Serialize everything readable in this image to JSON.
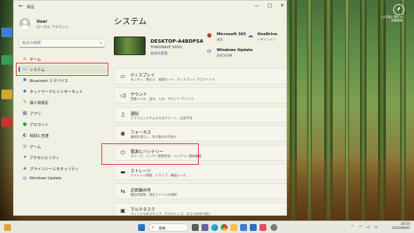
{
  "window": {
    "title": "設定",
    "back_glyph": "←",
    "minimize_glyph": "—",
    "maximize_glyph": "□",
    "close_glyph": "✕"
  },
  "account": {
    "name": "User",
    "type": "ローカル アカウント"
  },
  "search": {
    "placeholder": "設定の検索"
  },
  "nav": {
    "items": [
      {
        "label": "ホーム",
        "icon": "home-icon",
        "glyph": "⌂",
        "color": "#d46a2e"
      },
      {
        "label": "システム",
        "icon": "system-icon",
        "glyph": "▭",
        "color": "#2b6cc4",
        "active": true
      },
      {
        "label": "Bluetooth とデバイス",
        "icon": "bluetooth-icon",
        "glyph": "✱",
        "color": "#2b6cc4"
      },
      {
        "label": "ネットワークとインターネット",
        "icon": "network-icon",
        "glyph": "◆",
        "color": "#3b7fd6"
      },
      {
        "label": "個人用設定",
        "icon": "personalization-icon",
        "glyph": "✎",
        "color": "#c2702a"
      },
      {
        "label": "アプリ",
        "icon": "apps-icon",
        "glyph": "▦",
        "color": "#5b6a7e"
      },
      {
        "label": "アカウント",
        "icon": "accounts-icon",
        "glyph": "●",
        "color": "#2f9b55"
      },
      {
        "label": "時刻と言語",
        "icon": "time-language-icon",
        "glyph": "◐",
        "color": "#2b7bc4"
      },
      {
        "label": "ゲーム",
        "icon": "gaming-icon",
        "glyph": "◎",
        "color": "#6b6b6b"
      },
      {
        "label": "アクセシビリティ",
        "icon": "accessibility-icon",
        "glyph": "✦",
        "color": "#2b6cc4"
      },
      {
        "label": "プライバシーとセキュリティ",
        "icon": "privacy-shield-icon",
        "glyph": "◈",
        "color": "#6b6b6b"
      },
      {
        "label": "Windows Update",
        "icon": "windows-update-icon",
        "glyph": "⟳",
        "color": "#2b6cc4"
      }
    ]
  },
  "main": {
    "title": "システム",
    "device": {
      "name": "DESKTOP-A4BDPSA",
      "model": "THIRDWAVE SA50i",
      "rename": "名前の変更"
    },
    "status": [
      {
        "title": "Microsoft 365",
        "sub": "表示",
        "icon": "microsoft365-icon",
        "glyph": "⬢",
        "color": "#c0392b"
      },
      {
        "title": "OneDrive",
        "sub": "• サインイン",
        "icon": "onedrive-icon",
        "glyph": "☁",
        "color": "#1e6fc4"
      },
      {
        "title": "Windows Update",
        "sub": "対処が必要",
        "icon": "windows-update-icon",
        "glyph": "⟳",
        "color": "#1e6fc4"
      }
    ],
    "settings": [
      {
        "title": "ディスプレイ",
        "sub": "モニター、明るさ、夜間モード、ディスプレイ プロファイル",
        "icon": "display-icon",
        "glyph": "▭"
      },
      {
        "title": "サウンド",
        "sub": "音量レベル、出力、入力、サウンド デバイス",
        "icon": "sound-icon",
        "glyph": "◁)"
      },
      {
        "title": "通知",
        "sub": "アプリとシステムからのアラート、応答不可",
        "icon": "notification-bell-icon",
        "glyph": "♫"
      },
      {
        "title": "フォーカス",
        "sub": "通知を減らし、気が散るのを防ぐ",
        "icon": "focus-icon",
        "glyph": "◉"
      },
      {
        "title": "電源とバッテリー",
        "sub": "スリープ、バッテリ使用状況、バッテリー節約機能",
        "icon": "power-icon",
        "glyph": "⏻"
      },
      {
        "title": "ストレージ",
        "sub": "ストレージ領域、ドライブ、構成ルール",
        "icon": "storage-icon",
        "glyph": "▬"
      },
      {
        "title": "近距離共有",
        "sub": "検出可能性、受信ファイルの場所",
        "icon": "nearby-sharing-icon",
        "glyph": "⇆"
      },
      {
        "title": "マルチタスク",
        "sub": "ウィンドウのスナップ、デスクトップ、タスクの切り替え",
        "icon": "multitasking-icon",
        "glyph": "▣"
      }
    ]
  },
  "taskbar": {
    "search_label": "検索",
    "time": "16:53",
    "date": "2025/08/05"
  },
  "desktop": {
    "top_right_label": "この写真に関する\n詳細情報"
  }
}
